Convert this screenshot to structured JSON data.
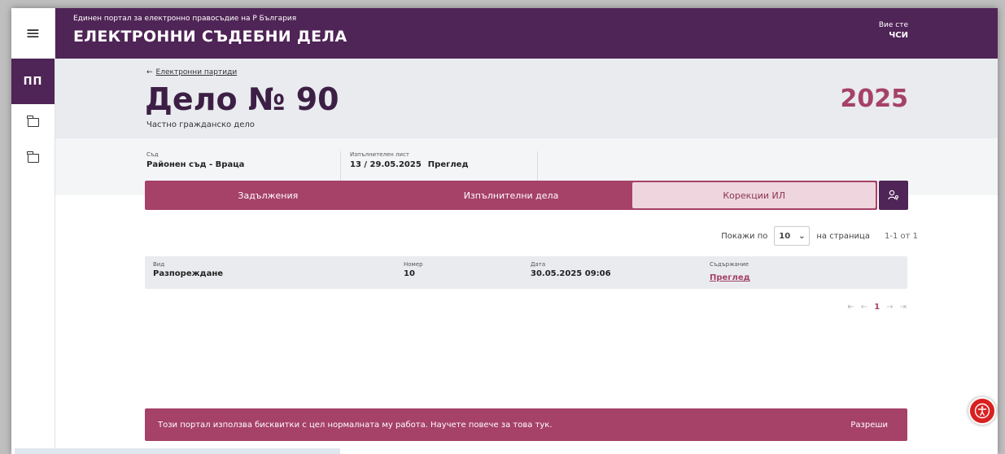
{
  "header": {
    "portal_name": "Единен портал за електронно правосъдие на Р България",
    "app_title": "ЕЛЕКТРОННИ СЪДЕБНИ ДЕЛА",
    "user_label": "Вие сте",
    "user_role": "ЧСИ"
  },
  "rail": {
    "user_initials": "ПП",
    "menu_icon": "hamburger-icon",
    "folder_icon": "folder-icon"
  },
  "case": {
    "back_arrow": "←",
    "back_label": "Електронни партиди",
    "title": "Дело № 90",
    "type": "Частно гражданско дело",
    "year": "2025"
  },
  "info": {
    "court_label": "Съд",
    "court_value": "Районен съд - Враца",
    "writ_label": "Изпълнителен лист",
    "writ_value": "13 / 29.05.2025",
    "writ_link": "Преглед"
  },
  "tabs": [
    {
      "label": "Задължения",
      "active": false
    },
    {
      "label": "Изпълнителни дела",
      "active": false
    },
    {
      "label": "Корекции ИЛ",
      "active": true
    }
  ],
  "pager": {
    "show_label": "Покажи по",
    "page_size": "10",
    "per_page_label": "на страница",
    "range": "1-1 от 1"
  },
  "table": {
    "headers": [
      "Вид",
      "Номер",
      "Дата",
      "Съдържание"
    ],
    "rows": [
      {
        "type": "Разпореждане",
        "number": "10",
        "date": "30.05.2025 09:06",
        "content": "Преглед"
      }
    ]
  },
  "pagination": {
    "first": "⇤",
    "prev": "←",
    "current": "1",
    "next": "→",
    "last": "⇥"
  },
  "cookie": {
    "text": "Този портал използва бисквитки с цел нормалната му работа. Научете повече за това тук.",
    "accept": "Разреши"
  },
  "colors": {
    "primary": "#4f2456",
    "accent": "#a64167",
    "band": "#e9ebef"
  }
}
